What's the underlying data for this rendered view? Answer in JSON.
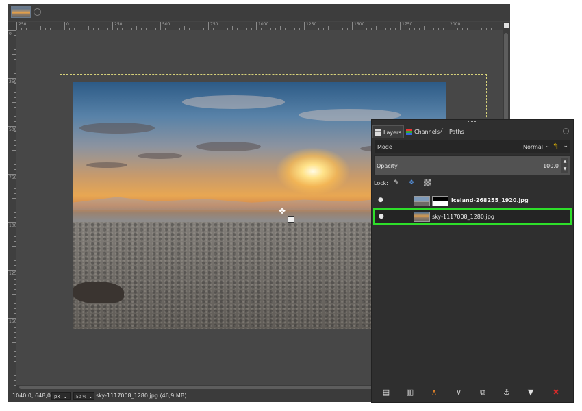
{
  "ruler": {
    "top_labels": [
      "250",
      "0",
      "250",
      "500",
      "750",
      "1000",
      "1250",
      "1500",
      "1750",
      "2000"
    ],
    "left_labels": [
      "0",
      "250",
      "500",
      "750",
      "1000",
      "1250",
      "1500"
    ]
  },
  "statusbar": {
    "coords": "1040,0, 648,0",
    "unit": "px",
    "zoom": "50 %",
    "file_info": "sky-1117008_1280.jpg (46,9 MB)"
  },
  "layers_panel": {
    "tabs": [
      {
        "label": "Layers",
        "icon": "layers-icon"
      },
      {
        "label": "Channels",
        "icon": "channels-icon"
      },
      {
        "label": "Paths",
        "icon": "paths-icon"
      }
    ],
    "mode_label": "Mode",
    "mode_value": "Normal",
    "opacity_label": "Opacity",
    "opacity_value": "100.0",
    "lock_label": "Lock:",
    "layers": [
      {
        "name": "iceland-268255_1920.jpg",
        "visible": true,
        "has_mask": true,
        "selected": false
      },
      {
        "name": "sky-1117008_1280.jpg",
        "visible": true,
        "has_mask": false,
        "selected": true
      }
    ]
  },
  "colors": {
    "selection_outline": "#2edf2a",
    "canvas_boundary": "#d7d27a",
    "mode_switch_icon": "#f0c000",
    "raise_icon": "#e8862a"
  },
  "icons": {
    "lock_pixels": "paintbrush-icon",
    "lock_position": "move-icon",
    "lock_alpha": "checkerboard-icon",
    "bottom_bar": [
      "new-layer-icon",
      "new-layer-group-icon",
      "raise-layer-icon",
      "lower-layer-icon",
      "duplicate-layer-icon",
      "anchor-layer-icon",
      "merge-down-icon",
      "delete-layer-icon"
    ]
  }
}
